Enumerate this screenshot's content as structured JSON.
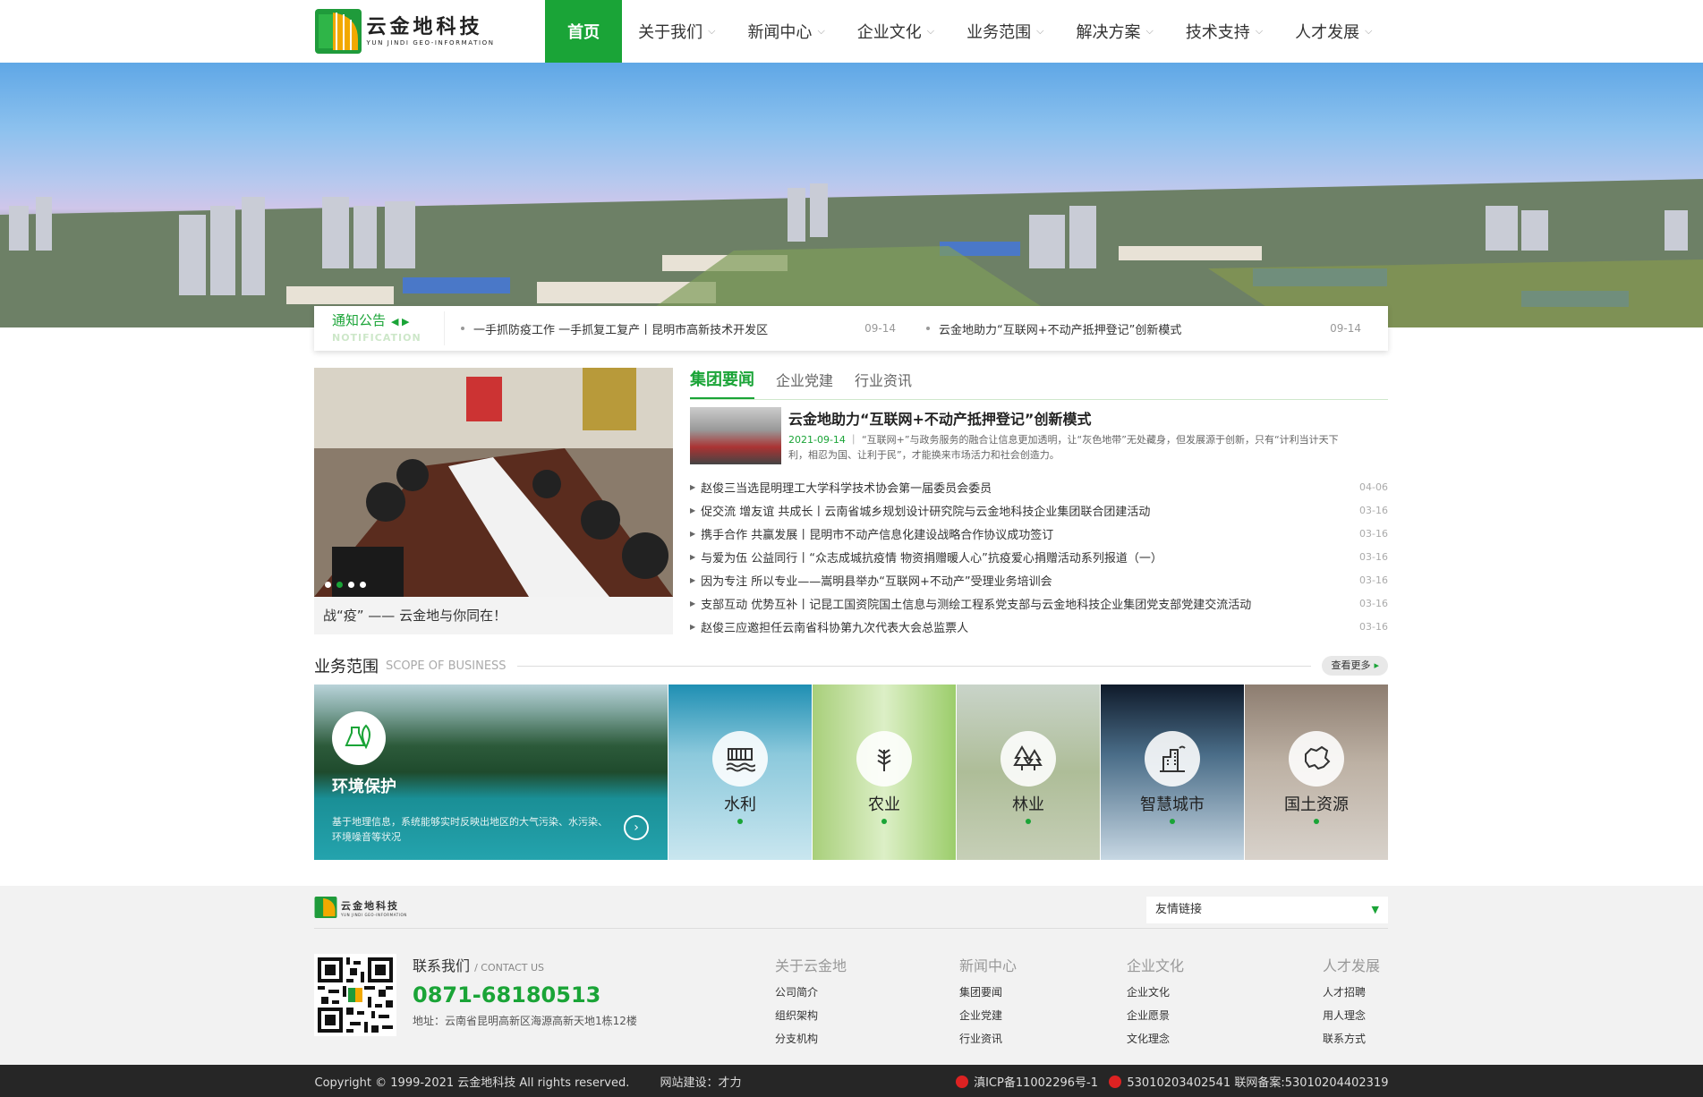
{
  "brand": {
    "name_cn": "云金地科技",
    "name_en": "YUN JINDI GEO-INFORMATION"
  },
  "nav": {
    "items": [
      "首页",
      "关于我们",
      "新闻中心",
      "企业文化",
      "业务范围",
      "解决方案",
      "技术支持",
      "人才发展"
    ]
  },
  "notice": {
    "title": "通知公告",
    "subtitle": "NOTIFICATION",
    "items": [
      {
        "text": "一手抓防疫工作 一手抓复工复产丨昆明市高新技术开发区",
        "date": "09-14"
      },
      {
        "text": "云金地助力“互联网+不动产抵押登记”创新模式",
        "date": "09-14"
      }
    ]
  },
  "slider": {
    "caption": "战“疫” —— 云金地与你同在！"
  },
  "news": {
    "tabs": [
      "集团要闻",
      "企业党建",
      "行业资讯"
    ],
    "featured": {
      "title": "云金地助力“互联网+不动产抵押登记”创新模式",
      "date": "2021-09-14",
      "summary": "“互联网+”与政务服务的融合让信息更加透明，让“灰色地带”无处藏身，但发展源于创新，只有“计利当计天下利，相忍为国、让利于民”，才能换来市场活力和社会创造力。"
    },
    "list": [
      {
        "title": "赵俊三当选昆明理工大学科学技术协会第一届委员会委员",
        "date": "04-06"
      },
      {
        "title": "促交流 增友谊 共成长丨云南省城乡规划设计研究院与云金地科技企业集团联合团建活动",
        "date": "03-16"
      },
      {
        "title": "携手合作 共赢发展丨昆明市不动产信息化建设战略合作协议成功签订",
        "date": "03-16"
      },
      {
        "title": "与爱为伍 公益同行丨“众志成城抗疫情 物资捐赠暖人心”抗疫爱心捐赠活动系列报道（一）",
        "date": "03-16"
      },
      {
        "title": "因为专注 所以专业——嵩明县举办“互联网+不动产”受理业务培训会",
        "date": "03-16"
      },
      {
        "title": "支部互动 优势互补丨记昆工国资院国土信息与测绘工程系党支部与云金地科技企业集团党支部党建交流活动",
        "date": "03-16"
      },
      {
        "title": "赵俊三应邀担任云南省科协第九次代表大会总监票人",
        "date": "03-16"
      }
    ]
  },
  "business": {
    "title": "业务范围",
    "subtitle": "SCOPE OF BUSINESS",
    "more": "查看更多",
    "featured": {
      "name": "环境保护",
      "desc": "基于地理信息，系统能够实时反映出地区的大气污染、水污染、环境噪音等状况"
    },
    "items": [
      "水利",
      "农业",
      "林业",
      "智慧城市",
      "国土资源"
    ]
  },
  "footer": {
    "links_label": "友情链接",
    "contact_title": "联系我们",
    "contact_en": "/ CONTACT US",
    "phone": "0871-68180513",
    "address": "地址：云南省昆明高新区海源高新天地1栋12楼",
    "cols": [
      {
        "title": "关于云金地",
        "items": [
          "公司简介",
          "组织架构",
          "分支机构"
        ]
      },
      {
        "title": "新闻中心",
        "items": [
          "集团要闻",
          "企业党建",
          "行业资讯"
        ]
      },
      {
        "title": "企业文化",
        "items": [
          "企业文化",
          "企业愿景",
          "文化理念"
        ]
      },
      {
        "title": "人才发展",
        "items": [
          "人才招聘",
          "用人理念",
          "联系方式"
        ]
      }
    ],
    "copyright": "Copyright © 1999-2021 云金地科技 All rights reserved.",
    "builder": "网站建设：才力",
    "icp": "滇ICP备11002296号-1",
    "police": "53010203402541 联网备案:53010204402319"
  }
}
